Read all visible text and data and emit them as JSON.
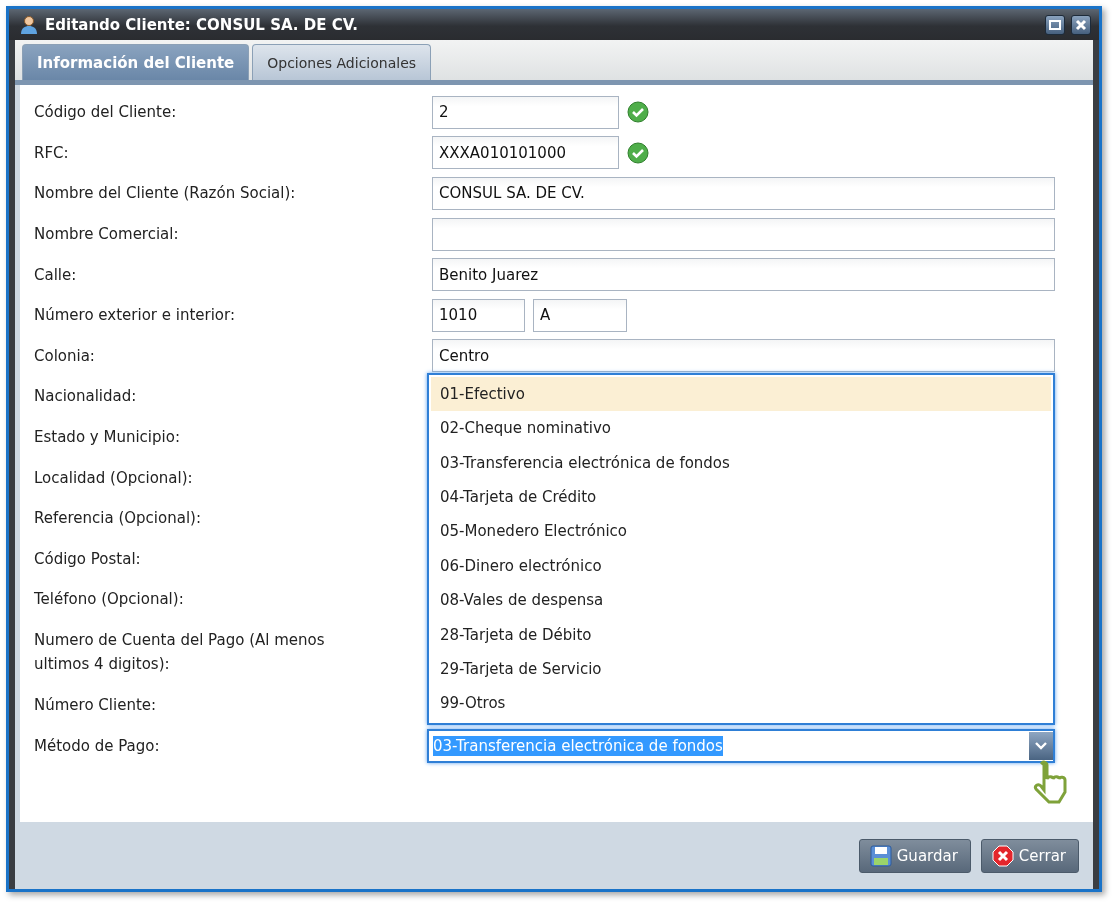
{
  "window": {
    "title": "Editando Cliente: CONSUL SA. DE CV."
  },
  "tabs": [
    {
      "label": "Información del Cliente",
      "selected": true
    },
    {
      "label": "Opciones Adicionales",
      "selected": false
    }
  ],
  "form": {
    "rows": [
      {
        "label": "Código del Cliente:",
        "kind": "short",
        "value": "2",
        "valid": true
      },
      {
        "label": "RFC:",
        "kind": "short",
        "value": "XXXA010101000",
        "valid": true
      },
      {
        "label": "Nombre del Cliente (Razón Social):",
        "kind": "full",
        "value": "CONSUL SA. DE CV."
      },
      {
        "label": "Nombre Comercial:",
        "kind": "full"
      },
      {
        "label": "Calle:",
        "kind": "full",
        "value": "Benito Juarez"
      },
      {
        "label": "Número exterior e interior:",
        "kind": "pair",
        "values": [
          "1010",
          "A"
        ]
      },
      {
        "label": "Colonia:",
        "kind": "full",
        "value": "Centro"
      },
      {
        "label": "Nacionalidad:",
        "kind": "covered"
      },
      {
        "label": "Estado y Municipio:",
        "kind": "covered"
      },
      {
        "label": "Localidad (Opcional):",
        "kind": "covered"
      },
      {
        "label": "Referencia (Opcional):",
        "kind": "covered"
      },
      {
        "label": "Código Postal:",
        "kind": "covered"
      },
      {
        "label": "Teléfono (Opcional):",
        "kind": "covered"
      },
      {
        "label": "Numero de Cuenta del Pago (Al menos ultimos 4 digitos):",
        "kind": "covered"
      },
      {
        "label": "Número Cliente:",
        "kind": "covered"
      },
      {
        "label": "Método de Pago:",
        "kind": "combo",
        "value": "03-Transferencia electrónica de fondos",
        "expanded": true
      }
    ]
  },
  "dropdown": {
    "options": [
      {
        "label": "01-Efectivo",
        "selected": true
      },
      {
        "label": "02-Cheque nominativo",
        "selected": false
      },
      {
        "label": "03-Transferencia electrónica de fondos",
        "selected": false
      },
      {
        "label": "04-Tarjeta de Crédito",
        "selected": false
      },
      {
        "label": "05-Monedero Electrónico",
        "selected": false
      },
      {
        "label": "06-Dinero electrónico",
        "selected": false
      },
      {
        "label": "08-Vales de despensa",
        "selected": false
      },
      {
        "label": "28-Tarjeta de Débito",
        "selected": false
      },
      {
        "label": "29-Tarjeta de Servicio",
        "selected": false
      },
      {
        "label": "99-Otros",
        "selected": false
      }
    ]
  },
  "buttons": [
    {
      "kind": "save",
      "label": "Guardar"
    },
    {
      "kind": "close",
      "label": "Cerrar"
    }
  ]
}
